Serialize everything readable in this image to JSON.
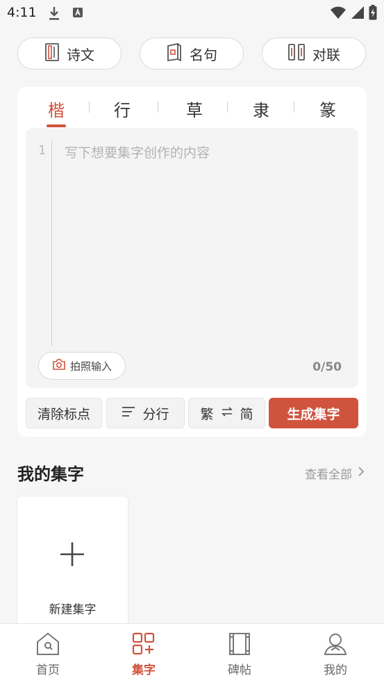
{
  "status_bar": {
    "time": "4:11"
  },
  "categories": [
    {
      "label": "诗文",
      "icon": "scroll-icon"
    },
    {
      "label": "名句",
      "icon": "book-icon"
    },
    {
      "label": "对联",
      "icon": "couplet-icon"
    }
  ],
  "style_tabs": [
    {
      "label": "楷",
      "active": true
    },
    {
      "label": "行"
    },
    {
      "label": "草"
    },
    {
      "label": "隶"
    },
    {
      "label": "篆"
    }
  ],
  "editor": {
    "line_number": "1",
    "placeholder": "写下想要集字创作的内容",
    "photo_input_label": "拍照输入",
    "counter": "0/50"
  },
  "actions": {
    "clear_punct": "清除标点",
    "split_lines": "分行",
    "trad": "繁",
    "simp": "简",
    "generate": "生成集字"
  },
  "my_section": {
    "title": "我的集字",
    "view_all": "查看全部",
    "new_label": "新建集字"
  },
  "bottom_nav": [
    {
      "label": "首页",
      "icon": "home-icon"
    },
    {
      "label": "集字",
      "icon": "grid-plus-icon",
      "active": true
    },
    {
      "label": "碑帖",
      "icon": "tablet-icon"
    },
    {
      "label": "我的",
      "icon": "profile-icon"
    }
  ],
  "colors": {
    "accent": "#d0533d"
  }
}
